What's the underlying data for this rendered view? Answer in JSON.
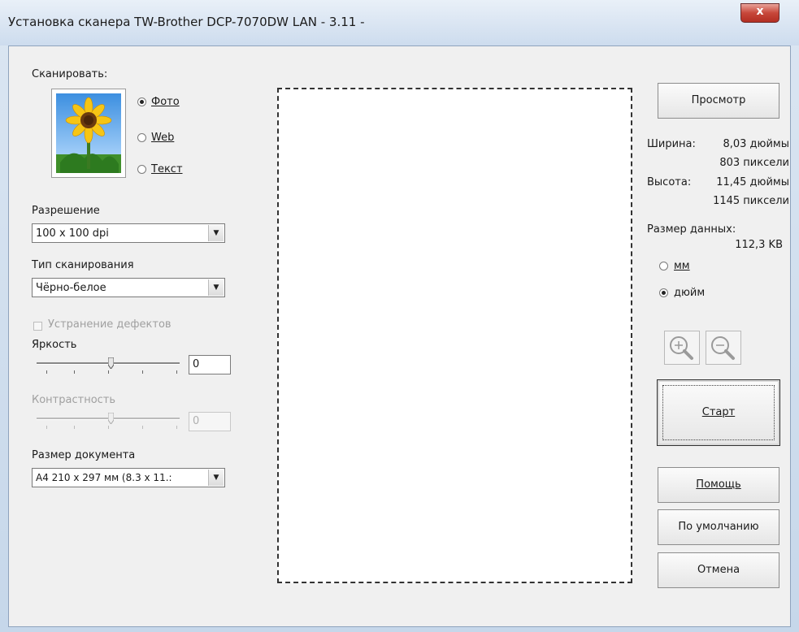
{
  "window": {
    "title": "Установка сканера TW-Brother DCP-7070DW LAN - 3.11 -",
    "close_glyph": "x"
  },
  "scan": {
    "label": "Сканировать:",
    "options": [
      {
        "label": "Фото",
        "selected": true
      },
      {
        "label": "Web",
        "selected": false
      },
      {
        "label": "Текст",
        "selected": false
      }
    ]
  },
  "resolution": {
    "label": "Разрешение",
    "value": "100 x 100 dpi"
  },
  "scan_type": {
    "label": "Тип сканирования",
    "value": "Чёрно-белое"
  },
  "descreen": {
    "label": "Устранение дефектов",
    "enabled": false
  },
  "brightness": {
    "label": "Яркость",
    "value": "0"
  },
  "contrast": {
    "label": "Контрастность",
    "value": "0",
    "enabled": false
  },
  "doc_size": {
    "label": "Размер документа",
    "value": "A4 210 x 297 мм (8.3 x 11.:"
  },
  "buttons": {
    "preview": "Просмотр",
    "start": "Старт",
    "help": "Помощь",
    "default": "По умолчанию",
    "cancel": "Отмена"
  },
  "info": {
    "width_label": "Ширина:",
    "width_in": "8,03 дюймы",
    "width_px": "803 пиксели",
    "height_label": "Высота:",
    "height_in": "11,45 дюймы",
    "height_px": "1145 пиксели",
    "data_size_label": "Размер данных:",
    "data_size_value": "112,3 KB"
  },
  "units": [
    {
      "label": "мм",
      "selected": false
    },
    {
      "label": "дюйм",
      "selected": true
    }
  ],
  "icons": [
    "zoom-in-icon",
    "zoom-out-icon",
    "chevron-down-icon",
    "close-icon",
    "sunflower-thumbnail"
  ]
}
